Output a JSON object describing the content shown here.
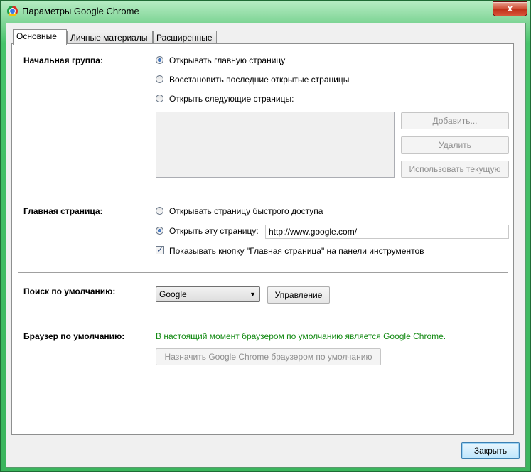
{
  "window": {
    "title": "Параметры Google Chrome",
    "close_glyph": "x"
  },
  "tabs": [
    {
      "label": "Основные",
      "active": true
    },
    {
      "label": "Личные материалы",
      "active": false
    },
    {
      "label": "Расширенные",
      "active": false
    }
  ],
  "startup": {
    "label": "Начальная группа:",
    "options": [
      {
        "label": "Открывать главную страницу",
        "selected": true
      },
      {
        "label": "Восстановить последние открытые страницы",
        "selected": false
      },
      {
        "label": "Открыть следующие страницы:",
        "selected": false
      }
    ],
    "buttons": {
      "add": "Добавить...",
      "remove": "Удалить",
      "use_current": "Использовать текущую"
    }
  },
  "homepage": {
    "label": "Главная страница:",
    "options": [
      {
        "label": "Открывать страницу быстрого доступа",
        "selected": false
      },
      {
        "label": "Открыть эту страницу:",
        "selected": true
      }
    ],
    "url": "http://www.google.com/",
    "show_button_label": "Показывать кнопку \"Главная страница\" на панели инструментов",
    "show_button_checked": true
  },
  "search": {
    "label": "Поиск по умолчанию:",
    "engine": "Google",
    "manage_button": "Управление"
  },
  "default_browser": {
    "label": "Браузер по умолчанию:",
    "status": "В настоящий момент браузером по умолчанию является Google Chrome.",
    "make_default_button": "Назначить Google Chrome браузером по умолчанию"
  },
  "footer": {
    "close_button": "Закрыть"
  },
  "colors": {
    "status_green": "#138a13",
    "titlebar_green": "#46c36a",
    "close_red": "#c0321a"
  }
}
